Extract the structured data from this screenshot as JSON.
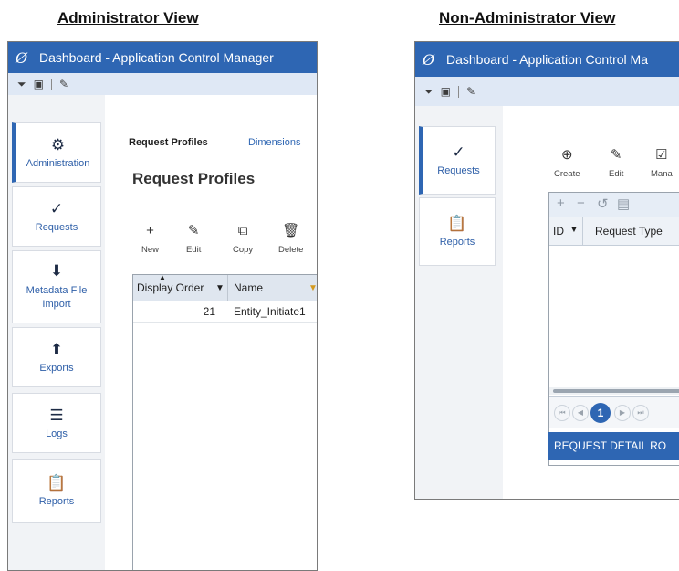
{
  "headings": {
    "admin": "Administrator View",
    "nonadmin": "Non-Administrator View"
  },
  "admin": {
    "title": "Dashboard - Application Control Manager",
    "nav": [
      {
        "label": "Administration",
        "icon": "administration-icon"
      },
      {
        "label": "Requests",
        "icon": "requests-icon"
      },
      {
        "label": "Metadata File Import",
        "icon": "import-icon"
      },
      {
        "label": "Exports",
        "icon": "exports-icon"
      },
      {
        "label": "Logs",
        "icon": "logs-icon"
      },
      {
        "label": "Reports",
        "icon": "reports-icon"
      }
    ],
    "tabs": [
      "Request Profiles",
      "Dimensions"
    ],
    "page_title": "Request Profiles",
    "actions": [
      "New",
      "Edit",
      "Copy",
      "Delete"
    ],
    "grid": {
      "columns": [
        "Display Order",
        "Name"
      ],
      "rows": [
        {
          "display_order": "21",
          "name": "Entity_Initiate1"
        }
      ]
    }
  },
  "nonadmin": {
    "title": "Dashboard - Application Control Ma",
    "nav": [
      {
        "label": "Requests",
        "icon": "requests-icon"
      },
      {
        "label": "Reports",
        "icon": "reports-icon"
      }
    ],
    "actions": [
      "Create",
      "Edit",
      "Mana"
    ],
    "grid": {
      "columns": [
        "ID",
        "Request Type"
      ],
      "current_page": "1"
    },
    "detail_label": "REQUEST DETAIL RO"
  },
  "colors": {
    "titlebar": "#2e66b3",
    "toolbar": "#dfe8f5",
    "accent": "#2e66b3"
  }
}
